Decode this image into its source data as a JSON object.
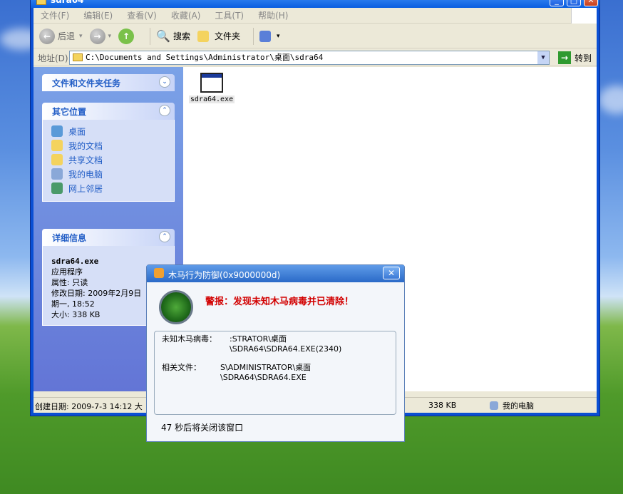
{
  "window": {
    "title": "sdra64"
  },
  "menu": [
    "文件(F)",
    "编辑(E)",
    "查看(V)",
    "收藏(A)",
    "工具(T)",
    "帮助(H)"
  ],
  "toolbar": {
    "back": "后退",
    "search": "搜索",
    "folders": "文件夹"
  },
  "address": {
    "label": "地址(D)",
    "value": "C:\\Documents and Settings\\Administrator\\桌面\\sdra64",
    "go": "转到"
  },
  "tasks": {
    "title": "文件和文件夹任务"
  },
  "places": {
    "title": "其它位置",
    "items": [
      "桌面",
      "我的文档",
      "共享文档",
      "我的电脑",
      "网上邻居"
    ]
  },
  "details": {
    "title": "详细信息",
    "filename": "sdra64.exe",
    "type": "应用程序",
    "attr": "属性: 只读",
    "modified_1": "修改日期: 2009年2月9日",
    "modified_2": "期一, 18:52",
    "size": "大小: 338 KB"
  },
  "file": {
    "name": "sdra64.exe"
  },
  "status": {
    "created": "创建日期: 2009-7-3 14:12 大",
    "size": "338 KB",
    "location": "我的电脑"
  },
  "popup": {
    "title": "木马行为防御(0x9000000d)",
    "warning": "警报：发现未知木马病毒并已清除！",
    "virus_label": "未知木马病毒：",
    "virus_value": ":STRATOR\\桌面\\SDRA64\\SDRA64.EXE(2340)",
    "file_label": "相关文件：",
    "file_value": "S\\ADMINISTRATOR\\桌面\\SDRA64\\SDRA64.EXE",
    "countdown": "47 秒后将关闭该窗口"
  }
}
